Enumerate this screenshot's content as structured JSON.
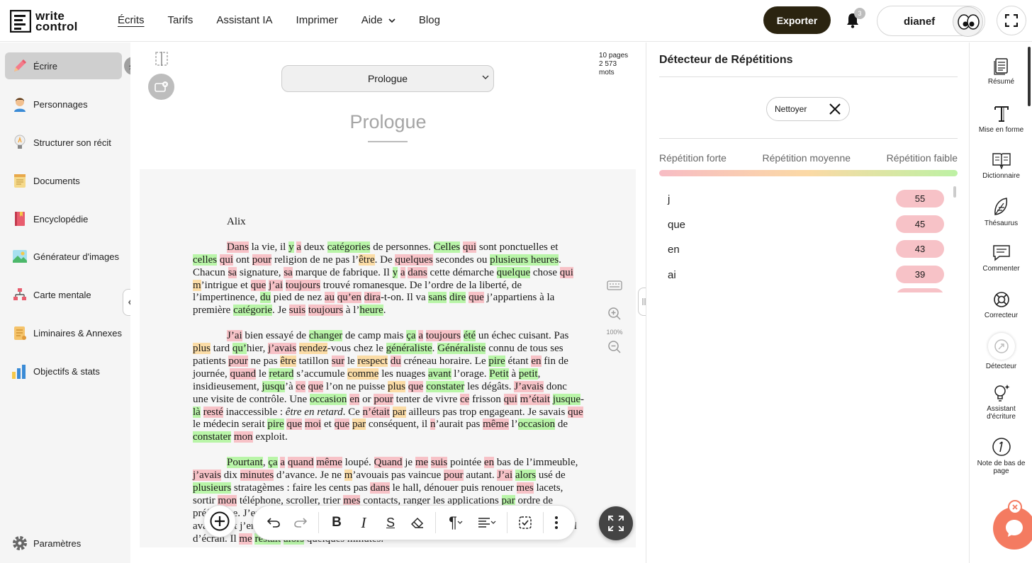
{
  "app": {
    "logo_line1": "write",
    "logo_line2": "control"
  },
  "nav": [
    {
      "label": "Écrits"
    },
    {
      "label": "Tarifs"
    },
    {
      "label": "Assistant IA"
    },
    {
      "label": "Imprimer"
    },
    {
      "label": "Aide"
    },
    {
      "label": "Blog"
    }
  ],
  "header": {
    "export_label": "Exporter",
    "notif_count": "3",
    "username": "dianef"
  },
  "sidebar": {
    "items": [
      {
        "label": "Écrire",
        "icon": "pencil-icon"
      },
      {
        "label": "Personnages",
        "icon": "person-icon"
      },
      {
        "label": "Structurer son récit",
        "icon": "lightbulb-icon"
      },
      {
        "label": "Documents",
        "icon": "notepad-icon"
      },
      {
        "label": "Encyclopédie",
        "icon": "book-icon"
      },
      {
        "label": "Générateur d'images",
        "icon": "image-icon"
      },
      {
        "label": "Carte mentale",
        "icon": "mindmap-icon"
      },
      {
        "label": "Liminaires & Annexes",
        "icon": "scroll-icon"
      },
      {
        "label": "Objectifs & stats",
        "icon": "chart-icon"
      }
    ],
    "settings_label": "Paramètres"
  },
  "editor": {
    "chapter_select": "Prologue",
    "pages": "10 pages",
    "words_count": "2 573",
    "words_label": "mots",
    "chapter_title": "Prologue",
    "zoom": "100%",
    "speaker": "Alix"
  },
  "repetitions": {
    "title": "Détecteur de Répétitions",
    "clean_label": "Nettoyer",
    "legend": [
      "Répétition forte",
      "Répétition moyenne",
      "Répétition faible"
    ],
    "items": [
      {
        "word": "j",
        "count": "55"
      },
      {
        "word": "que",
        "count": "45"
      },
      {
        "word": "en",
        "count": "43"
      },
      {
        "word": "ai",
        "count": "39"
      }
    ]
  },
  "tools": [
    {
      "label": "Résumé"
    },
    {
      "label": "Mise en forme"
    },
    {
      "label": "Dictionnaire"
    },
    {
      "label": "Thésaurus"
    },
    {
      "label": "Commenter"
    },
    {
      "label": "Correcteur"
    },
    {
      "label": "Détecteur"
    },
    {
      "label": "Assistant d'écriture"
    },
    {
      "label": "Note de bas de page"
    }
  ],
  "colors": {
    "accent_dark": "#2b2410",
    "strong": "#f7c2c7",
    "medium": "#fbdca6",
    "weak": "#b9f5a8",
    "chat": "#f47b61"
  }
}
